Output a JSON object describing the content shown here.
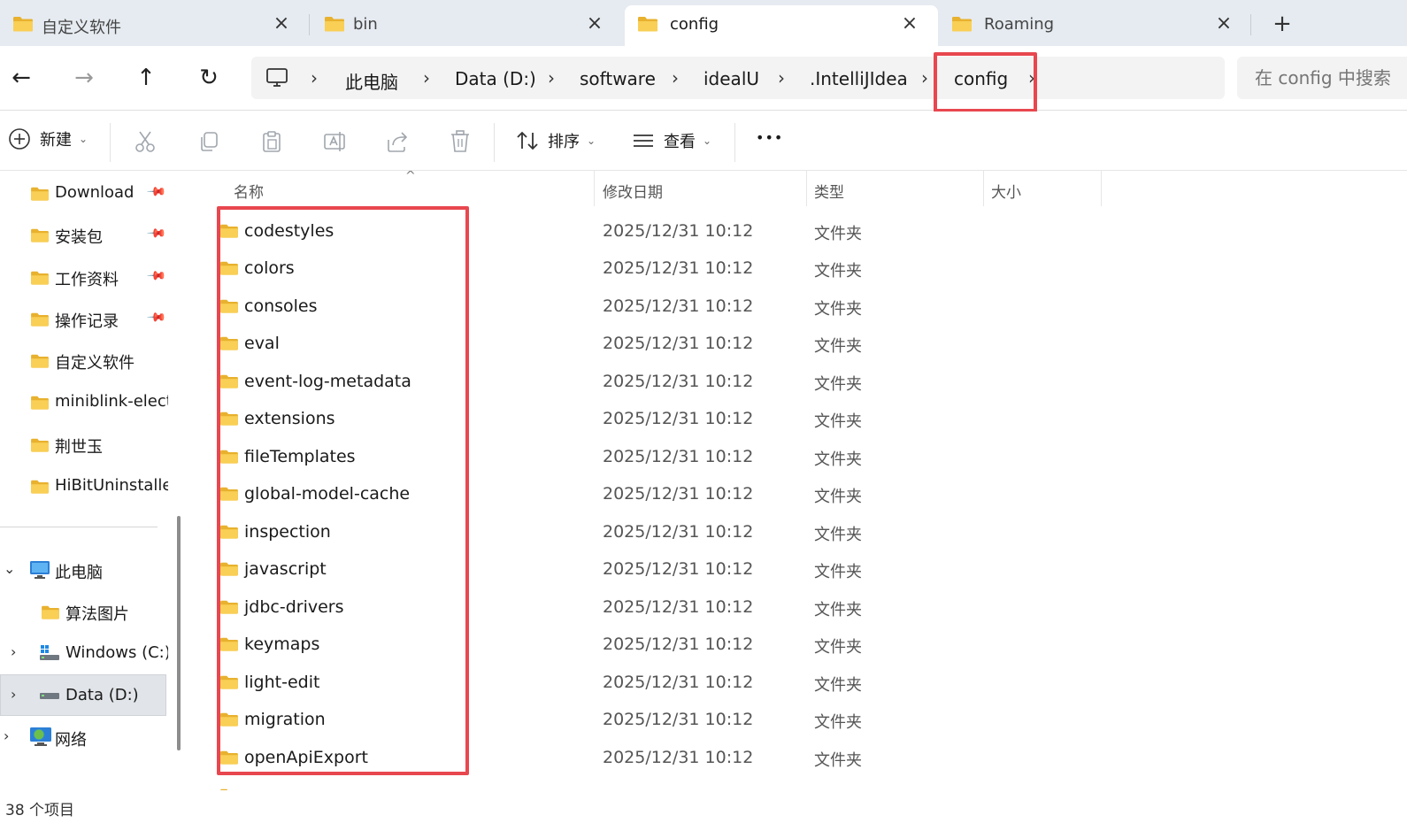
{
  "tabs": [
    {
      "label": "自定义软件",
      "active": false
    },
    {
      "label": "bin",
      "active": false
    },
    {
      "label": "config",
      "active": true
    },
    {
      "label": "Roaming",
      "active": false
    }
  ],
  "tab_icons": {
    "close": "×",
    "new": "+"
  },
  "nav": {
    "back": "←",
    "forward": "→",
    "up": "↑",
    "refresh": "↻"
  },
  "breadcrumb": {
    "separator": "›",
    "items": [
      "此电脑",
      "Data (D:)",
      "software",
      "idealU",
      ".IntelliJIdea",
      "config"
    ]
  },
  "search": {
    "placeholder": "在 config 中搜索"
  },
  "commandbar": {
    "new_label": "新建",
    "sort_label": "排序",
    "view_label": "查看",
    "more_label": "•••"
  },
  "sidebar": {
    "quick_access": [
      {
        "label": "Download",
        "pinned": true
      },
      {
        "label": "安装包",
        "pinned": true
      },
      {
        "label": "工作资料",
        "pinned": true
      },
      {
        "label": "操作记录",
        "pinned": true
      },
      {
        "label": "自定义软件",
        "pinned": false
      },
      {
        "label": "miniblink-elect",
        "pinned": false
      },
      {
        "label": "荆世玉",
        "pinned": false
      },
      {
        "label": "HiBitUninstalle",
        "pinned": false
      }
    ],
    "this_pc": "此电脑",
    "pictures": "算法图片",
    "drive_c": "Windows (C:)",
    "drive_d": "Data (D:)",
    "network": "网络"
  },
  "columns": {
    "name": "名称",
    "modified": "修改日期",
    "type": "类型",
    "size": "大小"
  },
  "files": [
    {
      "name": "codestyles",
      "date": "2025/12/31 10:12",
      "type": "文件夹"
    },
    {
      "name": "colors",
      "date": "2025/12/31 10:12",
      "type": "文件夹"
    },
    {
      "name": "consoles",
      "date": "2025/12/31 10:12",
      "type": "文件夹"
    },
    {
      "name": "eval",
      "date": "2025/12/31 10:12",
      "type": "文件夹"
    },
    {
      "name": "event-log-metadata",
      "date": "2025/12/31 10:12",
      "type": "文件夹"
    },
    {
      "name": "extensions",
      "date": "2025/12/31 10:12",
      "type": "文件夹"
    },
    {
      "name": "fileTemplates",
      "date": "2025/12/31 10:12",
      "type": "文件夹"
    },
    {
      "name": "global-model-cache",
      "date": "2025/12/31 10:12",
      "type": "文件夹"
    },
    {
      "name": "inspection",
      "date": "2025/12/31 10:12",
      "type": "文件夹"
    },
    {
      "name": "javascript",
      "date": "2025/12/31 10:12",
      "type": "文件夹"
    },
    {
      "name": "jdbc-drivers",
      "date": "2025/12/31 10:12",
      "type": "文件夹"
    },
    {
      "name": "keymaps",
      "date": "2025/12/31 10:12",
      "type": "文件夹"
    },
    {
      "name": "light-edit",
      "date": "2025/12/31 10:12",
      "type": "文件夹"
    },
    {
      "name": "migration",
      "date": "2025/12/31 10:12",
      "type": "文件夹"
    },
    {
      "name": "openApiExport",
      "date": "2025/12/31 10:12",
      "type": "文件夹"
    }
  ],
  "status": {
    "item_count": "38 个项目"
  },
  "colors": {
    "highlight": "#e8474f",
    "folder": "#f7c948",
    "tabbar": "#e6ebf1"
  }
}
